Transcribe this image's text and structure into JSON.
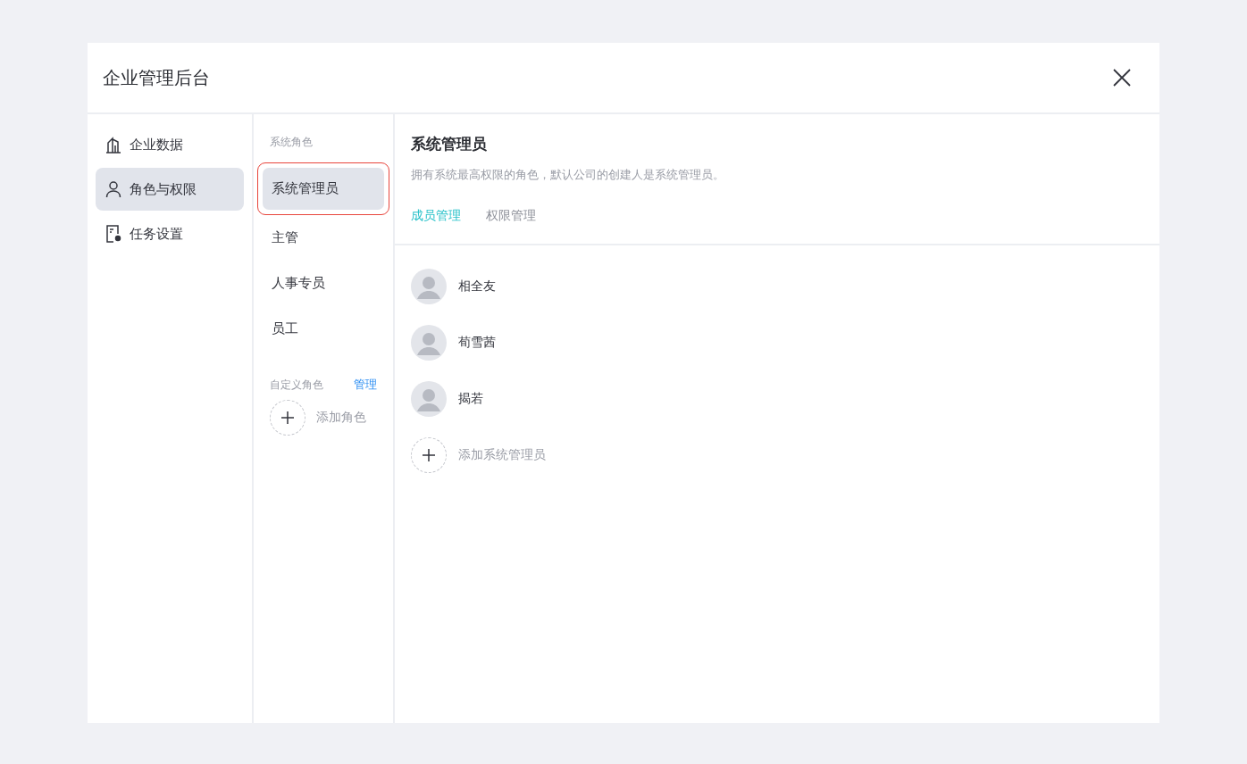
{
  "window": {
    "title": "企业管理后台"
  },
  "sidebar": {
    "items": [
      {
        "label": "企业数据",
        "kind": "building",
        "selected": false
      },
      {
        "label": "角色与权限",
        "kind": "user",
        "selected": true
      },
      {
        "label": "任务设置",
        "kind": "task",
        "selected": false
      }
    ]
  },
  "roles": {
    "system_heading": "系统角色",
    "system_roles": [
      {
        "label": "系统管理员",
        "selected": true,
        "highlighted": true
      },
      {
        "label": "主管",
        "selected": false,
        "highlighted": false
      },
      {
        "label": "人事专员",
        "selected": false,
        "highlighted": false
      },
      {
        "label": "员工",
        "selected": false,
        "highlighted": false
      }
    ],
    "custom_heading": "自定义角色",
    "manage_link": "管理",
    "add_role": "添加角色"
  },
  "detail": {
    "title": "系统管理员",
    "description": "拥有系统最高权限的角色，默认公司的创建人是系统管理员。",
    "tabs": [
      {
        "label": "成员管理",
        "selected": true
      },
      {
        "label": "权限管理",
        "selected": false
      }
    ],
    "members": [
      {
        "name": "相全友"
      },
      {
        "name": "荀雪茜"
      },
      {
        "name": "揭若"
      }
    ],
    "add_member": "添加系统管理员"
  }
}
